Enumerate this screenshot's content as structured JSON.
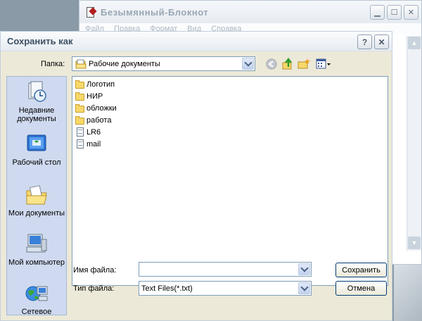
{
  "background": {
    "accent": "#8a9aa6"
  },
  "notepad": {
    "title": "Безымянный-Блокнот",
    "menu": [
      "Файл",
      "Правка",
      "Формат",
      "Вид",
      "Справка"
    ],
    "buttons": [
      "minimize-icon",
      "maximize-icon",
      "close-icon"
    ]
  },
  "dialog": {
    "title": "Сохранить как",
    "help_glyph": "?",
    "close_glyph": "✕",
    "folder_label": "Папка:",
    "folder_value": "Рабочие документы",
    "toolbar_icons": [
      "back-icon",
      "up-folder-icon",
      "new-folder-icon",
      "view-menu-icon"
    ],
    "places": [
      {
        "label": "Недавние документы",
        "icon": "recent-documents-icon"
      },
      {
        "label": "Рабочий стол",
        "icon": "desktop-icon"
      },
      {
        "label": "Мои документы",
        "icon": "my-documents-icon"
      },
      {
        "label": "Мой компьютер",
        "icon": "my-computer-icon"
      },
      {
        "label": "Сетевое",
        "icon": "network-icon"
      }
    ],
    "files": [
      {
        "name": "Логотип",
        "type": "folder"
      },
      {
        "name": "НИР",
        "type": "folder"
      },
      {
        "name": "обложки",
        "type": "folder"
      },
      {
        "name": "работа",
        "type": "folder"
      },
      {
        "name": "LR6",
        "type": "file"
      },
      {
        "name": "mail",
        "type": "file"
      }
    ],
    "filename_label": "Имя файла:",
    "filename_value": "",
    "filetype_label": "Тип файла:",
    "filetype_value": "Text Files(*.txt)",
    "save_button": "Сохранить",
    "cancel_button": "Отмена"
  }
}
